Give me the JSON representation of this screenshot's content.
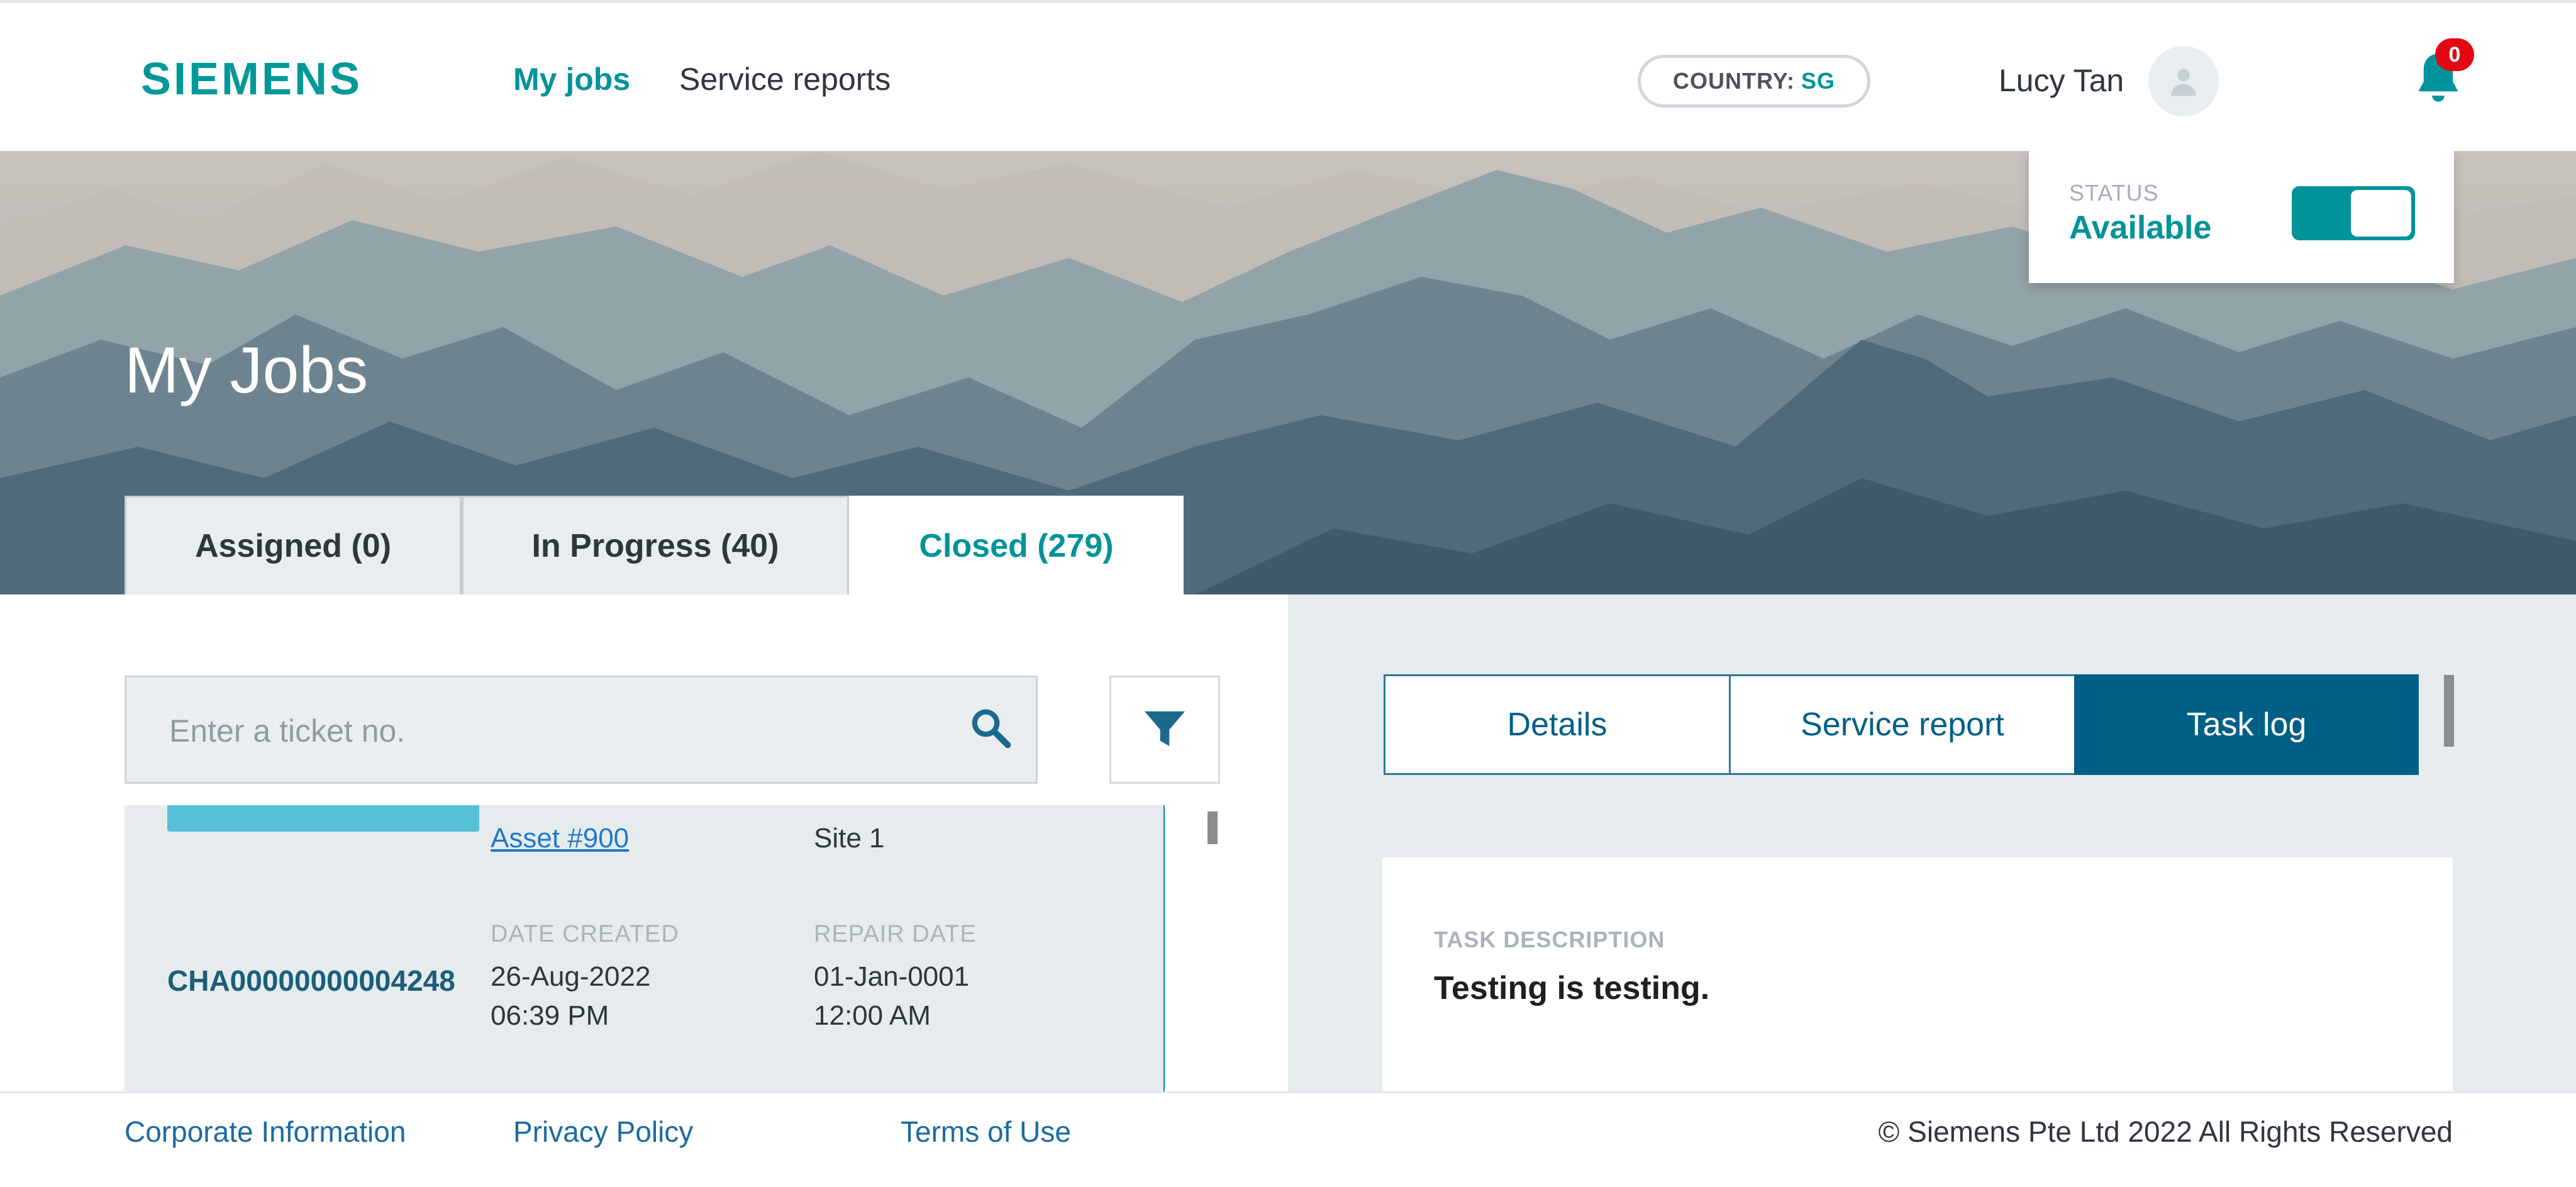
{
  "header": {
    "logo": "SIEMENS",
    "nav": [
      {
        "label": "My jobs",
        "active": true
      },
      {
        "label": "Service reports",
        "active": false
      }
    ],
    "country_label": "COUNTRY:",
    "country_code": "SG",
    "user_name": "Lucy Tan",
    "notification_count": "0",
    "icons": [
      "avatar-icon",
      "bell-icon"
    ]
  },
  "hero": {
    "title": "My Jobs",
    "status_label": "STATUS",
    "status_value": "Available",
    "status_toggle_on": true
  },
  "tabs": [
    {
      "label": "Assigned (0)",
      "active": false
    },
    {
      "label": "In Progress (40)",
      "active": false
    },
    {
      "label": "Closed (279)",
      "active": true
    }
  ],
  "search": {
    "placeholder": "Enter a ticket no.",
    "value": ""
  },
  "job_list": {
    "partial_row": {
      "asset": "Asset #900",
      "site": "Site 1"
    },
    "row": {
      "ticket": "CHA00000000004248",
      "date_created_label": "DATE CREATED",
      "date_created_date": "26-Aug-2022",
      "date_created_time": "06:39 PM",
      "repair_date_label": "REPAIR DATE",
      "repair_date_date": "01-Jan-0001",
      "repair_date_time": "12:00 AM"
    }
  },
  "detail_tabs": [
    {
      "label": "Details",
      "active": false
    },
    {
      "label": "Service report",
      "active": false
    },
    {
      "label": "Task log",
      "active": true
    }
  ],
  "task": {
    "description_label": "TASK DESCRIPTION",
    "description_value": "Testing is testing."
  },
  "footer": {
    "links": [
      "Corporate Information",
      "Privacy Policy",
      "Terms of Use"
    ],
    "copyright": "© Siemens Pte Ltd 2022 All Rights Reserved"
  },
  "colors": {
    "brand": "#009999",
    "accent": "#00939a",
    "active_tab": "#005f87",
    "badge": "#e30613",
    "link": "#1f7ac8",
    "list_highlight": "#55c0d8"
  }
}
